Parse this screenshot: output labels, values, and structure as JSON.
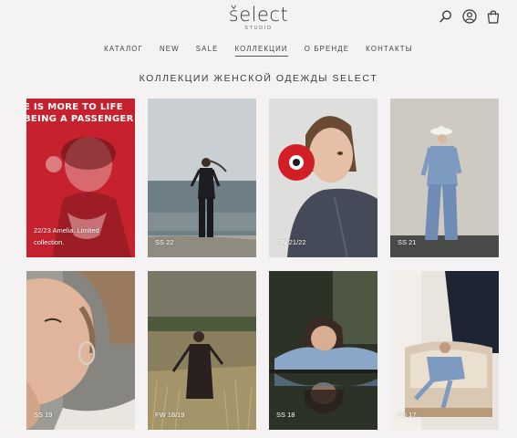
{
  "header": {
    "logo_main": "šelect",
    "logo_sub": "STUDIO",
    "icons": [
      "search-icon",
      "account-icon",
      "bag-icon"
    ]
  },
  "nav": {
    "items": [
      "КАТАЛОГ",
      "NEW",
      "SALE",
      "КОЛЛЕКЦИИ",
      "О БРЕНДЕ",
      "КОНТАКТЫ"
    ],
    "active": "КОЛЛЕКЦИИ"
  },
  "page_title": "КОЛЛЕКЦИИ ЖЕНСКОЙ ОДЕЖДЫ SELECT",
  "collections": [
    {
      "image_text": "E IS MORE TO LIFE\nBEING A PASSENGER",
      "caption": "22/23 Amelia. Limited collection."
    },
    {
      "caption": "SS 22"
    },
    {
      "caption": "FW 21/22"
    },
    {
      "caption": "SS 21"
    },
    {
      "caption": "SS 19"
    },
    {
      "caption": "FW 18/19"
    },
    {
      "caption": "SS 18"
    },
    {
      "caption": "SS 17"
    }
  ],
  "colors": {
    "background": "#f4f2f2",
    "text": "#333333",
    "red_tile": "#c9202e"
  }
}
